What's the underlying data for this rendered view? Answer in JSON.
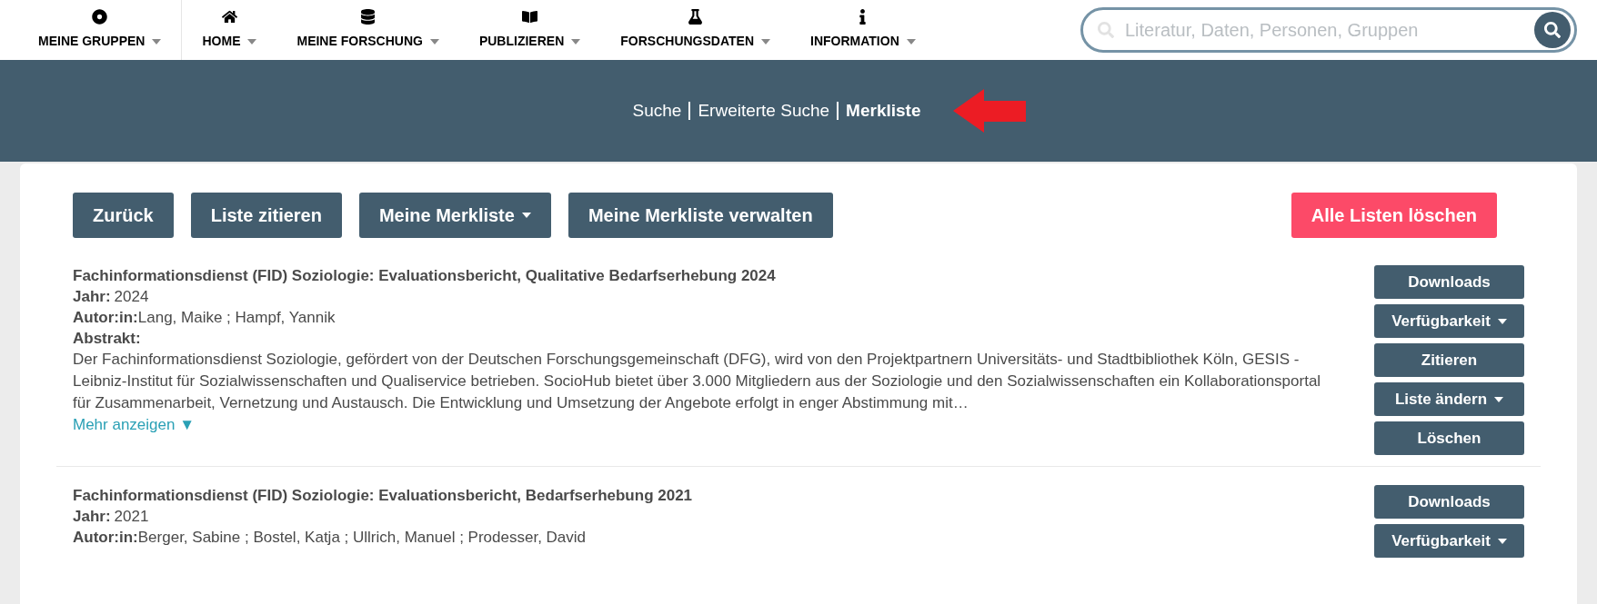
{
  "nav": {
    "items": [
      {
        "label": "MEINE GRUPPEN"
      },
      {
        "label": "HOME"
      },
      {
        "label": "MEINE FORSCHUNG"
      },
      {
        "label": "PUBLIZIEREN"
      },
      {
        "label": "FORSCHUNGSDATEN"
      },
      {
        "label": "INFORMATION"
      }
    ]
  },
  "search": {
    "placeholder": "Literatur, Daten, Personen, Gruppen"
  },
  "subnav": {
    "links": [
      {
        "label": "Suche",
        "selected": false
      },
      {
        "label": "Erweiterte Suche",
        "selected": false
      },
      {
        "label": "Merkliste",
        "selected": true
      }
    ]
  },
  "toolbar": {
    "buttons": [
      {
        "label": "Zurück",
        "kind": "plain"
      },
      {
        "label": "Liste zitieren",
        "kind": "plain"
      },
      {
        "label": "Meine Merkliste",
        "kind": "dropdown"
      },
      {
        "label": "Meine Merkliste verwalten",
        "kind": "plain"
      },
      {
        "label": "Alle Listen löschen",
        "kind": "danger"
      }
    ]
  },
  "results": [
    {
      "title": "Fachinformationsdienst (FID) Soziologie: Evaluationsbericht, Qualitative Bedarfserhebung 2024",
      "year_label": "Jahr:",
      "year": "2024",
      "author_label": "Autor:in:",
      "authors": "Lang, Maike ; Hampf, Yannik",
      "abstract_label": "Abstrakt:",
      "abstract": "Der Fachinformationsdienst Soziologie, gefördert von der Deutschen Forschungsgemeinschaft (DFG), wird von den Projektpartnern Universitäts- und Stadtbibliothek Köln, GESIS - Leibniz-Institut für Sozialwissenschaften und Qualiservice betrieben. SocioHub bietet über 3.000 Mitgliedern aus der Soziologie und den Sozialwissenschaften ein Kollaborationsportal für Zusammenarbeit, Vernetzung und Austausch. Die Entwicklung und Umsetzung der Angebote erfolgt in enger Abstimmung mit…",
      "more_link": "Mehr anzeigen ▼",
      "actions": [
        {
          "label": "Downloads",
          "dropdown": false
        },
        {
          "label": "Verfügbarkeit",
          "dropdown": true
        },
        {
          "label": "Zitieren",
          "dropdown": false
        },
        {
          "label": "Liste ändern",
          "dropdown": true
        },
        {
          "label": "Löschen",
          "dropdown": false
        }
      ]
    },
    {
      "title": "Fachinformationsdienst (FID) Soziologie: Evaluationsbericht, Bedarfserhebung 2021",
      "year_label": "Jahr:",
      "year": "2021",
      "author_label": "Autor:in:",
      "authors": "Berger, Sabine ; Bostel, Katja ; Ullrich, Manuel ; Prodesser, David",
      "actions": [
        {
          "label": "Downloads",
          "dropdown": false
        },
        {
          "label": "Verfügbarkeit",
          "dropdown": true
        }
      ]
    }
  ]
}
